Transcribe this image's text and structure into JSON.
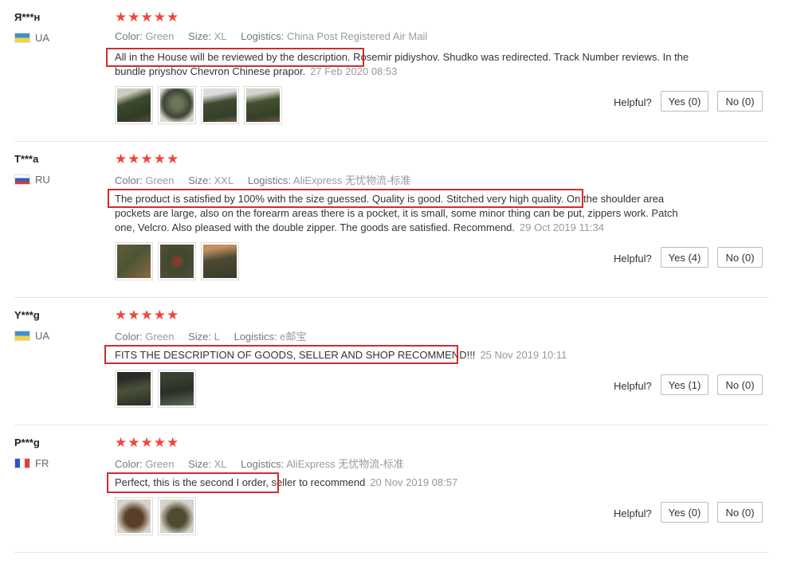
{
  "labels": {
    "color": "Color:",
    "size": "Size:",
    "logistics": "Logistics:",
    "helpful": "Helpful?"
  },
  "colors": {
    "star": "#f0463c",
    "highlight": "#d42a2a"
  },
  "reviews": [
    {
      "user": "Я***н",
      "country": "UA",
      "flag_icon": "ukraine-flag-icon",
      "stars": "★★★★★",
      "color": "Green",
      "size": "XL",
      "logistics": "China Post Registered Air Mail",
      "highlighted": "All in the House will be reviewed by the description.",
      "text": " Rosemir pidiyshov. Shudko was redirected. Track Number reviews. In the bundle priyshov Chevron Chinese prapor.",
      "date": "27 Feb 2020 08:53",
      "photos": 4,
      "yes": "Yes (0)",
      "no": "No (0)"
    },
    {
      "user": "T***a",
      "country": "RU",
      "flag_icon": "russia-flag-icon",
      "stars": "★★★★★",
      "color": "Green",
      "size": "XXL",
      "logistics": "AliExpress 无忧物流-标准",
      "highlighted": "The product is satisfied by 100% with the size guessed. Quality is good. Stitched very high quality.",
      "text": " On the shoulder area pockets are large, also on the forearm areas there is a pocket, it is small, some minor thing can be put, zippers work. Patch one, Velcro. Also pleased with the double zipper. The goods are satisfied. Recommend.",
      "date": "29 Oct 2019 11:34",
      "photos": 3,
      "yes": "Yes (4)",
      "no": "No (0)"
    },
    {
      "user": "Y***g",
      "country": "UA",
      "flag_icon": "ukraine-flag-icon",
      "stars": "★★★★★",
      "color": "Green",
      "size": "L",
      "logistics": "e邮宝",
      "highlighted": "FITS THE DESCRIPTION OF GOODS, SELLER AND SHOP RECOMMEND!!!",
      "text": "",
      "date": "25 Nov 2019 10:11",
      "photos": 2,
      "yes": "Yes (1)",
      "no": "No (0)"
    },
    {
      "user": "P***g",
      "country": "FR",
      "flag_icon": "france-flag-icon",
      "stars": "★★★★★",
      "color": "Green",
      "size": "XL",
      "logistics": "AliExpress 无忧物流-标准",
      "highlighted": "Perfect, this is the second I order,",
      "text": " seller to recommend",
      "date": "20 Nov 2019 08:57",
      "photos": 2,
      "yes": "Yes (0)",
      "no": "No (0)"
    }
  ]
}
